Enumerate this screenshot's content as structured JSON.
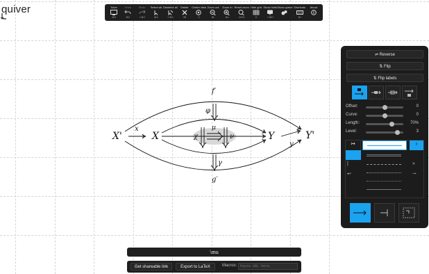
{
  "app": {
    "logo": "quiver"
  },
  "toolbar": {
    "buttons": [
      {
        "name": "Save",
        "key": "⌘S",
        "icon": "save-icon",
        "disabled": false
      },
      {
        "name": "Undo",
        "key": "⌘Z",
        "icon": "undo-icon",
        "disabled": true
      },
      {
        "name": "Redo",
        "key": "⇧⌘Z",
        "icon": "redo-icon",
        "disabled": true
      },
      {
        "name": "Select all",
        "key": "⌘A",
        "icon": "select-all-icon",
        "disabled": false
      },
      {
        "name": "Deselect all",
        "key": "⇧⌘A",
        "icon": "deselect-all-icon",
        "disabled": false
      },
      {
        "name": "Delete",
        "key": "⌫",
        "icon": "delete-icon",
        "disabled": false
      },
      {
        "name": "Centre view",
        "key": "G",
        "icon": "centre-view-icon",
        "disabled": false
      },
      {
        "name": "Zoom out",
        "key": "⌘-",
        "icon": "zoom-out-icon",
        "disabled": false
      },
      {
        "name": "Zoom in",
        "key": "⌘=",
        "icon": "zoom-in-icon",
        "disabled": false
      },
      {
        "name": "Reset zoom",
        "key": "100%",
        "icon": "reset-zoom-icon",
        "disabled": false
      },
      {
        "name": "Hide grid",
        "key": "H",
        "icon": "grid-icon",
        "disabled": false
      },
      {
        "name": "Show hints",
        "key": "⇧⌘H",
        "icon": "hints-icon",
        "disabled": false
      },
      {
        "name": "Show queue",
        "key": "",
        "icon": "queue-icon",
        "disabled": false
      },
      {
        "name": "Shortcuts",
        "key": "⌘/",
        "icon": "keyboard-icon",
        "disabled": false
      },
      {
        "name": "About",
        "key": "",
        "icon": "info-icon",
        "disabled": false
      }
    ]
  },
  "panel": {
    "reverse_label": "⇌ Reverse",
    "flip_label": "⇅ Flip",
    "flip_labels_label": "⇅ Flip labels",
    "offset_label": "Offset:",
    "offset_value": "0",
    "offset_level": 0.5,
    "curve_label": "Curve:",
    "curve_value": "0",
    "curve_level": 0.5,
    "length_label": "Length:",
    "length_value": "70%",
    "length_level": 0.7,
    "level_label": "Level:",
    "level_value": "3",
    "level_level": 0.85
  },
  "diagram": {
    "objects": [
      "X'",
      "X",
      "Y",
      "Y'"
    ],
    "arrow_labels": {
      "x": "x",
      "y": "y",
      "f": "f′",
      "g": "g′",
      "phi": "φ",
      "gamma": "γ",
      "mu": "μ",
      "chi": "χ",
      "nu": "ν"
    }
  },
  "latex_bar": {
    "text": "\\mu"
  },
  "export": {
    "share_label": "Get shareable link",
    "latex_label": "Export to LaTeX",
    "macros_label": "Macros:",
    "macros_placeholder": "Paste URL here."
  },
  "colors": {
    "accent": "#1aa3f0",
    "panel_bg": "#1c1c1c",
    "toolbar_bg": "#1f1f1f"
  }
}
